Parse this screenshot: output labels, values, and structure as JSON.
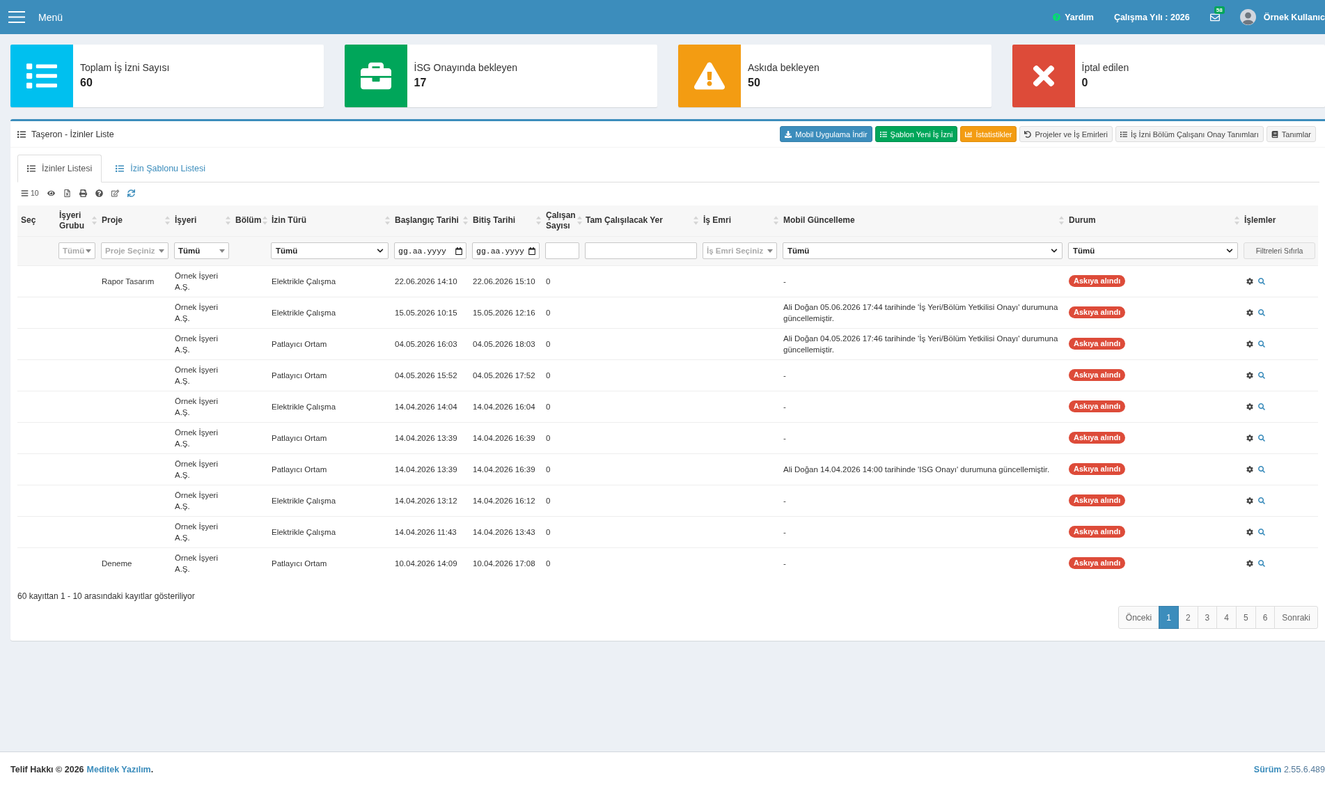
{
  "top_bar": {
    "menu_label": "Menü",
    "help": "Yardım",
    "work_year": "Çalışma Yılı : 2026",
    "mail_count": "58",
    "user_name": "Örnek Kullanıc"
  },
  "stat_cards": [
    {
      "label": "Toplam İş İzni Sayısı",
      "value": "60",
      "color": "#00c0ef"
    },
    {
      "label": "İSG Onayında bekleyen",
      "value": "17",
      "color": "#00a65a"
    },
    {
      "label": "Askıda bekleyen",
      "value": "50",
      "color": "#f39c12"
    },
    {
      "label": "İptal edilen",
      "value": "0",
      "color": "#dd4b39"
    }
  ],
  "panel": {
    "title": "Taşeron - İzinler Liste",
    "buttons": [
      {
        "label": "Mobil Uygulama İndir",
        "kind": "primary"
      },
      {
        "label": "Şablon Yeni İş İzni",
        "kind": "success"
      },
      {
        "label": "İstatistikler",
        "kind": "warning"
      },
      {
        "label": "Projeler ve İş Emirleri",
        "kind": "default"
      },
      {
        "label": "İş İzni Bölüm Çalışanı Onay Tanımları",
        "kind": "default"
      },
      {
        "label": "Tanımlar",
        "kind": "default"
      }
    ]
  },
  "tabs": [
    {
      "label": "İzinler Listesi",
      "selected": true
    },
    {
      "label": "İzin Şablonu Listesi",
      "selected": false
    }
  ],
  "table_toolbar": {
    "page_size": "10"
  },
  "table": {
    "columns": [
      {
        "label": "Seç",
        "sortable": false
      },
      {
        "label": "İşyeri Grubu",
        "sortable": true,
        "filter": {
          "kind": "combo",
          "placeholder": "Tümü"
        }
      },
      {
        "label": "Proje",
        "sortable": true,
        "filter": {
          "kind": "combo",
          "placeholder": "Proje Seçiniz"
        }
      },
      {
        "label": "İşyeri",
        "sortable": true,
        "filter": {
          "kind": "combo",
          "value": "Tümü"
        }
      },
      {
        "label": "Bölüm",
        "sortable": true
      },
      {
        "label": "İzin Türü",
        "sortable": true,
        "filter": {
          "kind": "select",
          "value": "Tümü"
        }
      },
      {
        "label": "Başlangıç Tarihi",
        "sortable": true,
        "filter": {
          "kind": "date",
          "placeholder": "gg.aa.yyyy"
        }
      },
      {
        "label": "Bitiş Tarihi",
        "sortable": true,
        "filter": {
          "kind": "date",
          "placeholder": "gg.aa.yyyy"
        }
      },
      {
        "label": "Çalışan Sayısı",
        "sortable": true,
        "filter": {
          "kind": "text"
        }
      },
      {
        "label": "Tam Çalışılacak Yer",
        "sortable": true,
        "filter": {
          "kind": "text"
        }
      },
      {
        "label": "İş Emri",
        "sortable": true,
        "filter": {
          "kind": "combo",
          "placeholder": "İş Emri Seçiniz"
        }
      },
      {
        "label": "Mobil Güncelleme",
        "sortable": true,
        "filter": {
          "kind": "select",
          "value": "Tümü"
        }
      },
      {
        "label": "Durum",
        "sortable": true,
        "filter": {
          "kind": "select",
          "value": "Tümü"
        }
      },
      {
        "label": "İşlemler",
        "sortable": false,
        "filter": {
          "kind": "button",
          "label": "Filtreleri Sıfırla"
        }
      }
    ],
    "rows": [
      {
        "project": "Rapor Tasarım",
        "workplace": "Örnek İşyeri A.Ş.",
        "permit_type": "Elektrikle Çalışma",
        "start": "22.06.2026 14:10",
        "end": "22.06.2026 15:10",
        "worker_count": "0",
        "mobile_update": "-",
        "status": "Askıya alındı"
      },
      {
        "workplace": "Örnek İşyeri A.Ş.",
        "permit_type": "Elektrikle Çalışma",
        "start": "15.05.2026 10:15",
        "end": "15.05.2026 12:16",
        "worker_count": "0",
        "mobile_update": "Ali Doğan 05.06.2026 17:44 tarihinde 'İş Yeri/Bölüm Yetkilisi Onayı' durumuna güncellemiştir.",
        "status": "Askıya alındı"
      },
      {
        "workplace": "Örnek İşyeri A.Ş.",
        "permit_type": "Patlayıcı Ortam",
        "start": "04.05.2026 16:03",
        "end": "04.05.2026 18:03",
        "worker_count": "0",
        "mobile_update": "Ali Doğan 04.05.2026 17:46 tarihinde 'İş Yeri/Bölüm Yetkilisi Onayı' durumuna güncellemiştir.",
        "status": "Askıya alındı"
      },
      {
        "workplace": "Örnek İşyeri A.Ş.",
        "permit_type": "Patlayıcı Ortam",
        "start": "04.05.2026 15:52",
        "end": "04.05.2026 17:52",
        "worker_count": "0",
        "mobile_update": "-",
        "status": "Askıya alındı"
      },
      {
        "workplace": "Örnek İşyeri A.Ş.",
        "permit_type": "Elektrikle Çalışma",
        "start": "14.04.2026 14:04",
        "end": "14.04.2026 16:04",
        "worker_count": "0",
        "mobile_update": "-",
        "status": "Askıya alındı"
      },
      {
        "workplace": "Örnek İşyeri A.Ş.",
        "permit_type": "Patlayıcı Ortam",
        "start": "14.04.2026 13:39",
        "end": "14.04.2026 16:39",
        "worker_count": "0",
        "mobile_update": "-",
        "status": "Askıya alındı"
      },
      {
        "workplace": "Örnek İşyeri A.Ş.",
        "permit_type": "Patlayıcı Ortam",
        "start": "14.04.2026 13:39",
        "end": "14.04.2026 16:39",
        "worker_count": "0",
        "mobile_update": "Ali Doğan 14.04.2026 14:00 tarihinde 'ISG Onayı' durumuna güncellemiştir.",
        "status": "Askıya alındı"
      },
      {
        "workplace": "Örnek İşyeri A.Ş.",
        "permit_type": "Elektrikle Çalışma",
        "start": "14.04.2026 13:12",
        "end": "14.04.2026 16:12",
        "worker_count": "0",
        "mobile_update": "-",
        "status": "Askıya alındı"
      },
      {
        "workplace": "Örnek İşyeri A.Ş.",
        "permit_type": "Elektrikle Çalışma",
        "start": "14.04.2026 11:43",
        "end": "14.04.2026 13:43",
        "worker_count": "0",
        "mobile_update": "-",
        "status": "Askıya alındı"
      },
      {
        "project": "Deneme",
        "workplace": "Örnek İşyeri A.Ş.",
        "permit_type": "Patlayıcı Ortam",
        "start": "10.04.2026 14:09",
        "end": "10.04.2026 17:08",
        "worker_count": "0",
        "mobile_update": "-",
        "status": "Askıya alındı"
      }
    ]
  },
  "table_info": "60 kayıttan 1 - 10 arasındaki kayıtlar gösteriliyor",
  "pagination": {
    "previous": "Önceki",
    "pages": [
      {
        "label": "1",
        "selected": true
      },
      {
        "label": "2",
        "selected": false
      },
      {
        "label": "3",
        "selected": false
      },
      {
        "label": "4",
        "selected": false
      },
      {
        "label": "5",
        "selected": false
      },
      {
        "label": "6",
        "selected": false
      }
    ],
    "next": "Sonraki"
  },
  "footer": {
    "copyright": "Telif Hakkı © 2026",
    "company": "Meditek Yazılım",
    "copyright_end": ".",
    "version": "**Sürüm** 2.55.6.489"
  }
}
